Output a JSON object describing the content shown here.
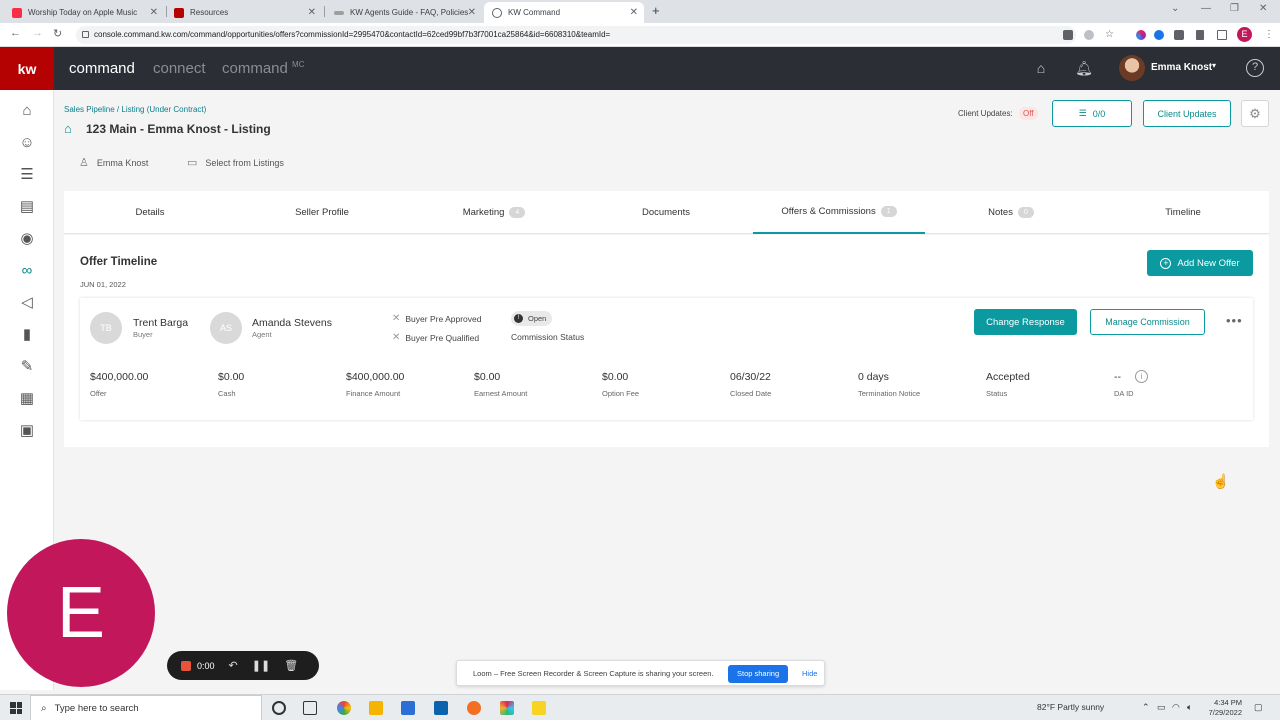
{
  "browser": {
    "tabs": [
      {
        "title": "Worship Today on Apple Music",
        "favicon_color": "#fa2d48"
      },
      {
        "title": "Resources",
        "favicon_color": "#b40101"
      },
      {
        "title": "KW Agents Guide - FAQ, Policies",
        "favicon_color": "#9e9e9e"
      },
      {
        "title": "KW Command",
        "favicon_color": "#5f6368"
      }
    ],
    "new_tab": "+",
    "url": "console.command.kw.com/command/opportunities/offers?commissionId=2995470&contactId=62ced99bf7b3f7001ca25864&id=6608310&teamId=",
    "profile_initial": "E"
  },
  "header": {
    "logo": "kw",
    "nav": [
      "command",
      "connect",
      "command"
    ],
    "nav_sup": "MC",
    "user_name": "Emma Knost"
  },
  "page": {
    "breadcrumb": "Sales Pipeline / Listing (Under Contract)",
    "title": "123 Main - Emma Knost - Listing",
    "contact": "Emma Knost",
    "select_listing": "Select from Listings",
    "client_updates_label": "Client Updates:",
    "client_updates_status": "Off",
    "tasks_count": "0/0",
    "client_updates_button": "Client Updates"
  },
  "tabs": [
    {
      "label": "Details"
    },
    {
      "label": "Seller Profile"
    },
    {
      "label": "Marketing",
      "count": "4"
    },
    {
      "label": "Documents"
    },
    {
      "label": "Offers & Commissions",
      "count": "1"
    },
    {
      "label": "Notes",
      "count": "0"
    },
    {
      "label": "Timeline"
    }
  ],
  "offers": {
    "heading": "Offer Timeline",
    "date": "JUN 01, 2022",
    "add_button": "Add New Offer",
    "buyer": {
      "initials": "TB",
      "name": "Trent Barga",
      "role": "Buyer"
    },
    "agent": {
      "initials": "AS",
      "name": "Amanda Stevens",
      "role": "Agent"
    },
    "checks": [
      "Buyer Pre Approved",
      "Buyer Pre Qualified"
    ],
    "status_badge": "Open",
    "status_label": "Commission Status",
    "change_response": "Change Response",
    "manage_commission": "Manage Commission",
    "more": "•••",
    "metrics": [
      {
        "value": "$400,000.00",
        "label": "Offer"
      },
      {
        "value": "$0.00",
        "label": "Cash"
      },
      {
        "value": "$400,000.00",
        "label": "Finance Amount"
      },
      {
        "value": "$0.00",
        "label": "Earnest Amount"
      },
      {
        "value": "$0.00",
        "label": "Option Fee"
      },
      {
        "value": "06/30/22",
        "label": "Closed Date"
      },
      {
        "value": "0 days",
        "label": "Termination Notice"
      },
      {
        "value": "Accepted",
        "label": "Status"
      },
      {
        "value": "--",
        "label": "DA ID"
      }
    ]
  },
  "loom": {
    "bubble_initial": "E",
    "timer": "0:00",
    "share_text": "Loom – Free Screen Recorder & Screen Capture is sharing your screen.",
    "stop_sharing": "Stop sharing",
    "hide": "Hide"
  },
  "taskbar": {
    "search_placeholder": "Type here to search",
    "weather": "82°F  Partly sunny",
    "time": "4:34 PM",
    "date": "7/29/2022"
  },
  "colors": {
    "brand_red": "#b40101",
    "teal": "#0a9aa0",
    "header_bg": "#2b2e34",
    "loom_pink": "#c2185b"
  }
}
